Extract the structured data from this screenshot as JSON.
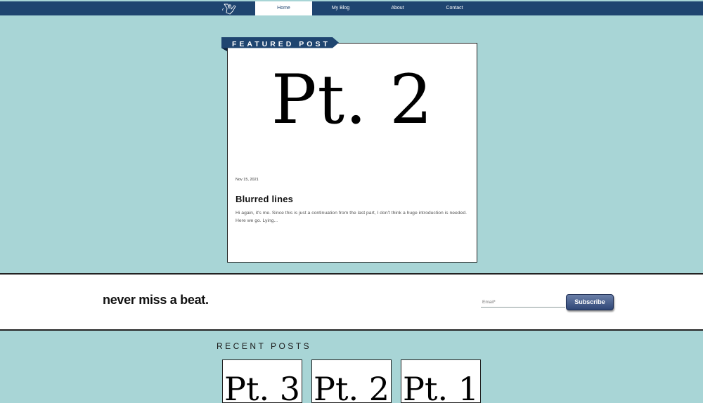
{
  "nav": {
    "items": [
      {
        "label": "Home",
        "active": true
      },
      {
        "label": "My Blog",
        "active": false
      },
      {
        "label": "About",
        "active": false
      },
      {
        "label": "Contact",
        "active": false
      }
    ]
  },
  "featured": {
    "ribbon": "FEATURED POST",
    "cover_title": "Pt. 2",
    "date": "Nov 15, 2021",
    "title": "Blurred lines",
    "excerpt": "Hi again, it's me. Since this is just a continuation from the last part, I don't think a huge introduction is needed. Here we go. Lying..."
  },
  "subscribe": {
    "tagline": "never miss a beat.",
    "email_placeholder": "Email*",
    "button_label": "Subscribe"
  },
  "recent": {
    "heading": "RECENT POSTS",
    "posts": [
      {
        "cover_title": "Pt. 3"
      },
      {
        "cover_title": "Pt. 2"
      },
      {
        "cover_title": "Pt. 1"
      }
    ]
  },
  "colors": {
    "page_background": "#a8d5d6",
    "nav_background": "#1f4570",
    "button_gradient_top": "#6a7fa8",
    "button_gradient_bottom": "#2f4676"
  }
}
